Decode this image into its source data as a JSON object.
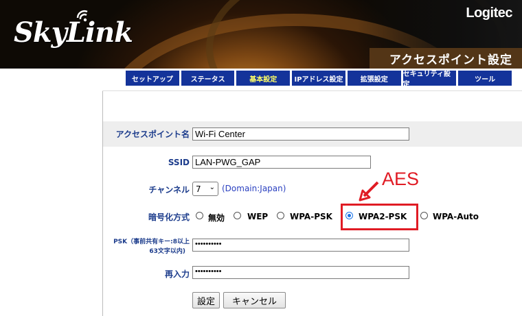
{
  "header": {
    "brand_logo": "SkyLink",
    "company_logo": "Logitec",
    "page_title": "アクセスポイント設定"
  },
  "nav": {
    "tabs": [
      {
        "label": "セットアップ",
        "active": false
      },
      {
        "label": "ステータス",
        "active": false
      },
      {
        "label": "基本設定",
        "active": true
      },
      {
        "label": "IPアドレス設定",
        "active": false
      },
      {
        "label": "拡張設定",
        "active": false
      },
      {
        "label": "セキュリティ設定",
        "active": false
      },
      {
        "label": "ツール",
        "active": false
      }
    ]
  },
  "form": {
    "ap_name_label": "アクセスポイント名",
    "ap_name_value": "Wi-Fi Center",
    "ssid_label": "SSID",
    "ssid_value": "LAN-PWG_GAP",
    "channel_label": "チャンネル",
    "channel_value": "7",
    "domain_text": "(Domain:Japan)",
    "encryption_label": "暗号化方式",
    "encryption_options": [
      "無効",
      "WEP",
      "WPA-PSK",
      "WPA2-PSK",
      "WPA-Auto"
    ],
    "encryption_selected": "WPA2-PSK",
    "psk_label_line1": "PSK（事前共有キー:8以上",
    "psk_label_line2": "63文字以内)",
    "psk_value": "••••••••••",
    "reenter_label": "再入力",
    "reenter_value": "••••••••••",
    "submit_label": "設定",
    "cancel_label": "キャンセル"
  },
  "annotation": {
    "text": "AES",
    "color": "#e01b24"
  },
  "colors": {
    "nav_bg": "#14339a",
    "label_color": "#1c3c8c"
  }
}
